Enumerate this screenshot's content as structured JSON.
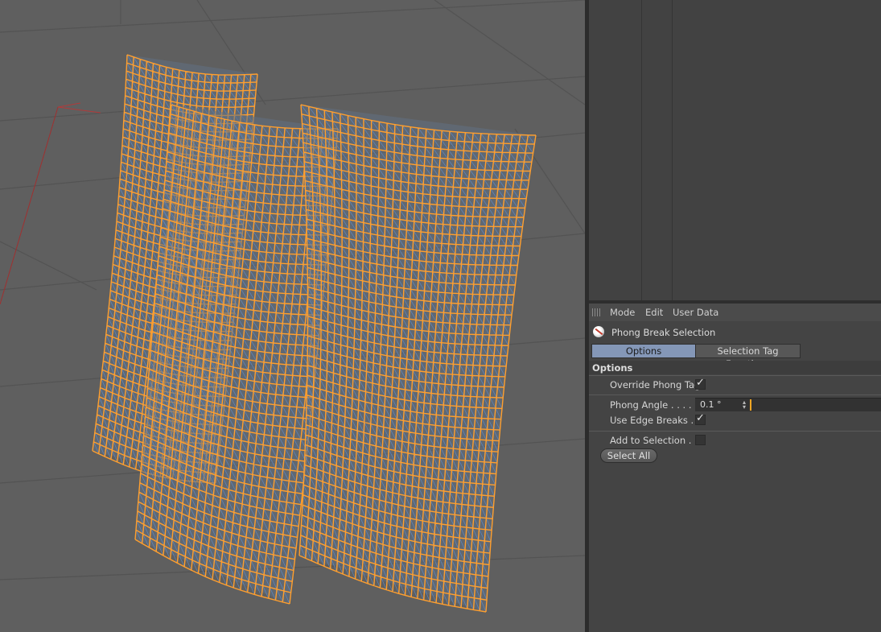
{
  "attribute_manager": {
    "menu": [
      "Mode",
      "Edit",
      "User Data"
    ],
    "tag_name": "Phong Break Selection",
    "tabs": [
      "Options",
      "Selection Tag Functions"
    ],
    "active_tab": "Options",
    "section_title": "Options",
    "override_phong_tag": {
      "label": "Override Phong Tag",
      "checked": true
    },
    "phong_angle": {
      "label": "Phong Angle . . . . .",
      "value": "0.1 °"
    },
    "use_edge_breaks": {
      "label": "Use Edge Breaks . .",
      "checked": true
    },
    "add_to_selection": {
      "label": "Add to Selection . .",
      "checked": false
    },
    "select_all_button": "Select All"
  },
  "viewport": {
    "wire_color": "#ff9f2e",
    "background_color": "#5f5f5f",
    "surface_color": "#616f82",
    "edge_color": "#5b8fd6"
  },
  "colors": {
    "active_tab": "#8497b7",
    "slider_cursor": "#f5a623"
  }
}
